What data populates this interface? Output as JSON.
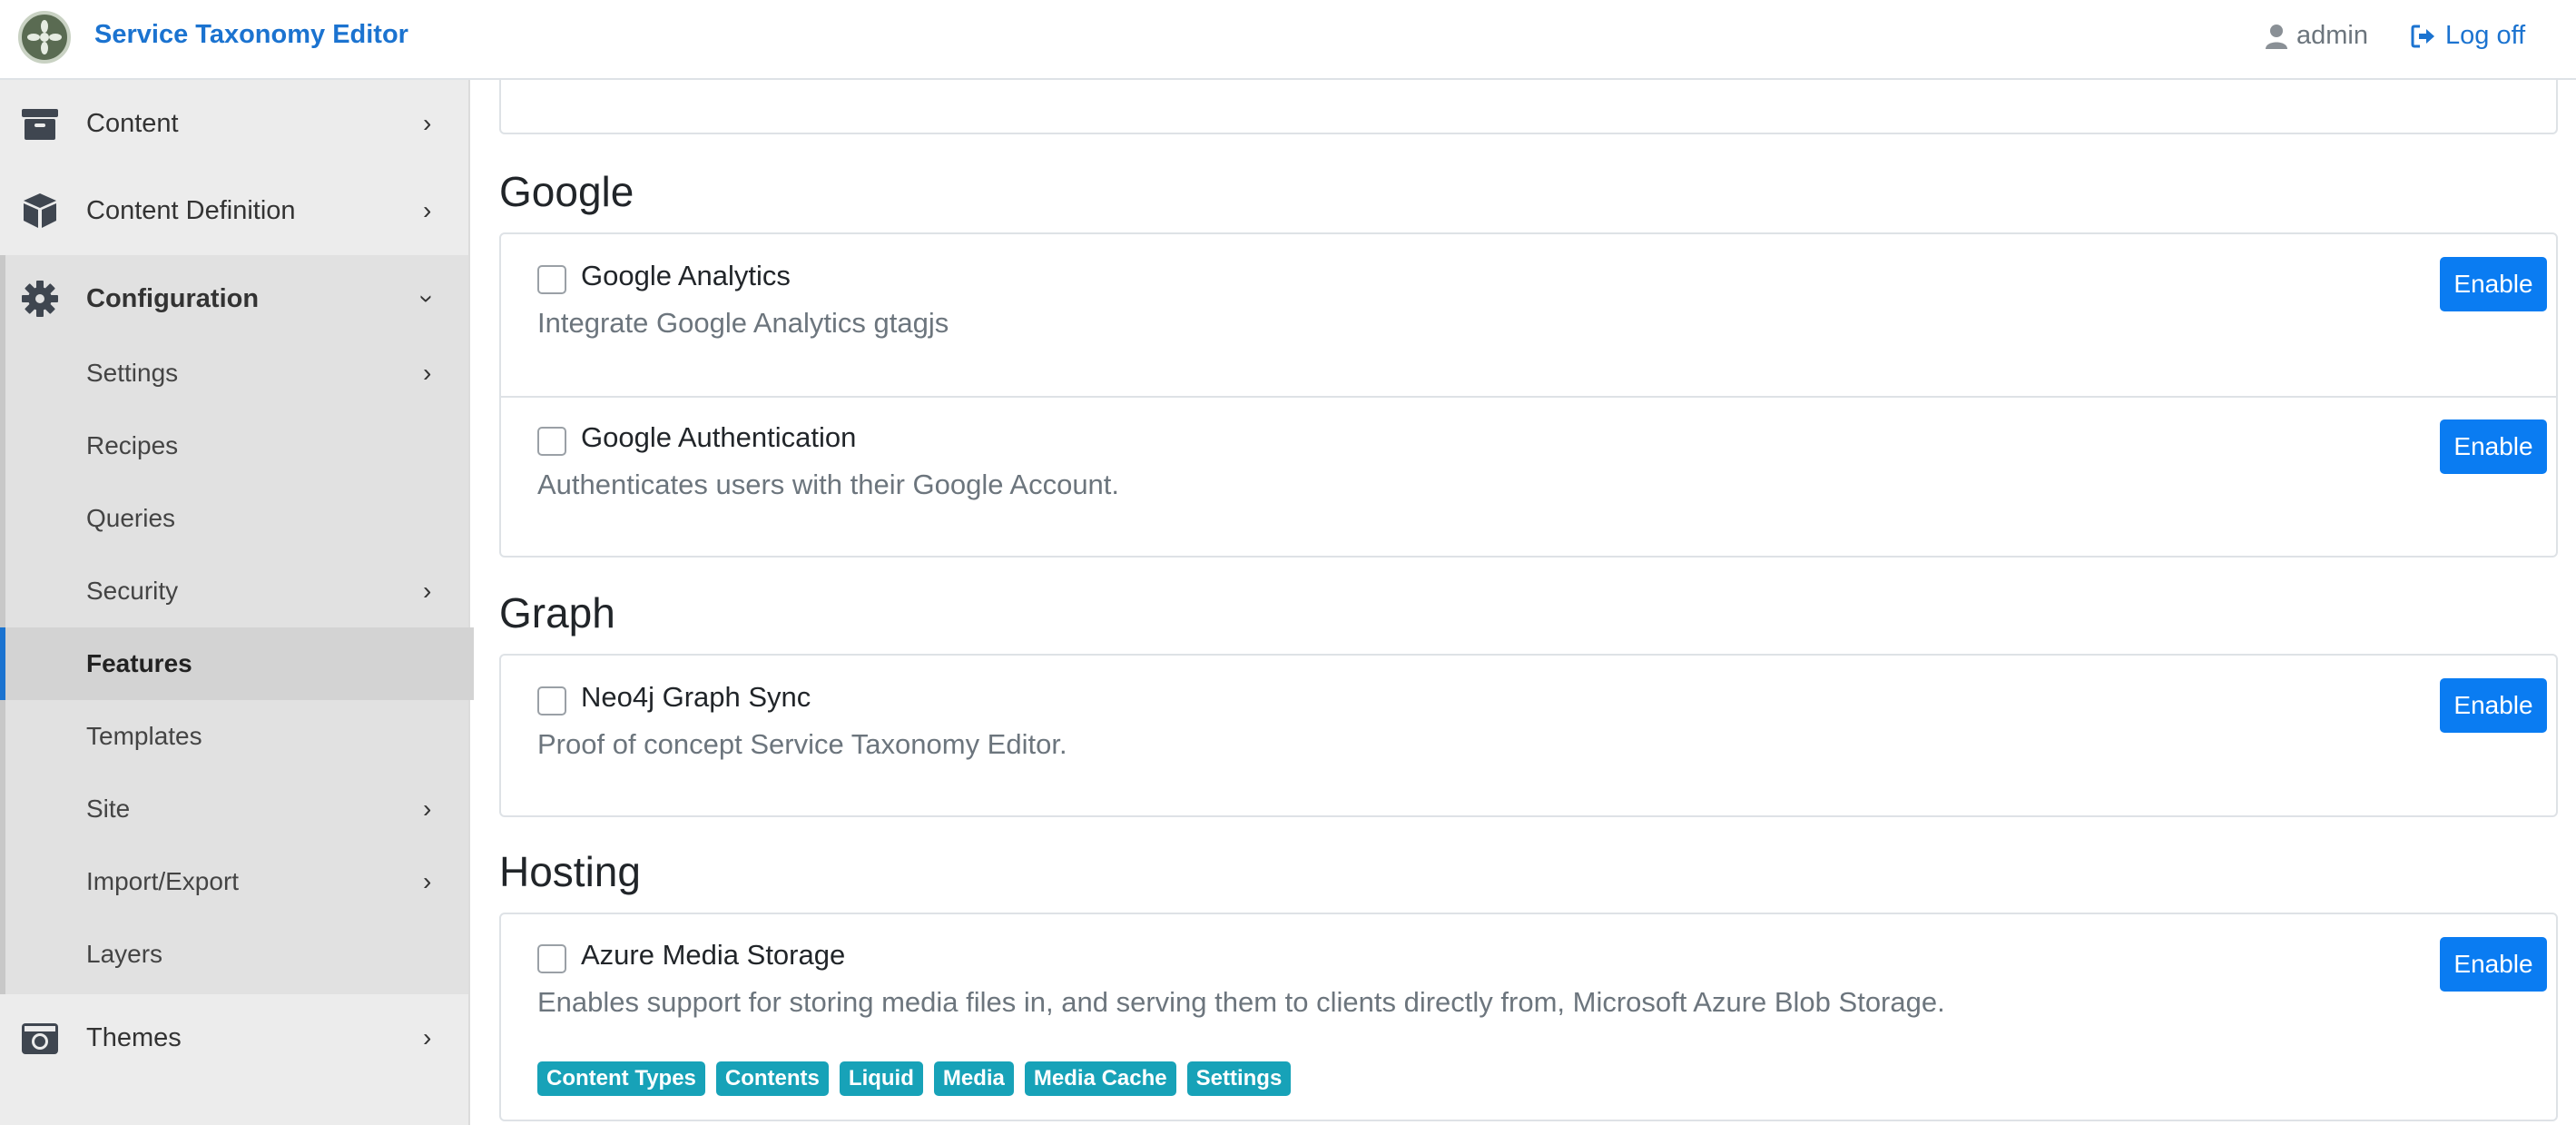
{
  "header": {
    "brand": "Service Taxonomy Editor",
    "user": "admin",
    "logoff": "Log off"
  },
  "sidebar": {
    "content": "Content",
    "content_definition": "Content Definition",
    "configuration": "Configuration",
    "sub_items": [
      "Settings",
      "Recipes",
      "Queries",
      "Security",
      "Features",
      "Templates",
      "Site",
      "Import/Export",
      "Layers"
    ],
    "themes": "Themes"
  },
  "sections": {
    "google": {
      "title": "Google",
      "features": [
        {
          "name": "Google Analytics",
          "description": "Integrate Google Analytics gtagjs",
          "button": "Enable"
        },
        {
          "name": "Google Authentication",
          "description": "Authenticates users with their Google Account.",
          "button": "Enable"
        }
      ]
    },
    "graph": {
      "title": "Graph",
      "features": [
        {
          "name": "Neo4j Graph Sync",
          "description": "Proof of concept Service Taxonomy Editor.",
          "button": "Enable"
        }
      ]
    },
    "hosting": {
      "title": "Hosting",
      "features": [
        {
          "name": "Azure Media Storage",
          "description": "Enables support for storing media files in, and serving them to clients directly from, Microsoft Azure Blob Storage.",
          "button": "Enable",
          "tags": [
            "Content Types",
            "Contents",
            "Liquid",
            "Media",
            "Media Cache",
            "Settings"
          ]
        }
      ]
    }
  },
  "colors": {
    "accent": "#0a7cf2",
    "tag": "#17a2b8",
    "active_bar": "#1b73d0"
  }
}
